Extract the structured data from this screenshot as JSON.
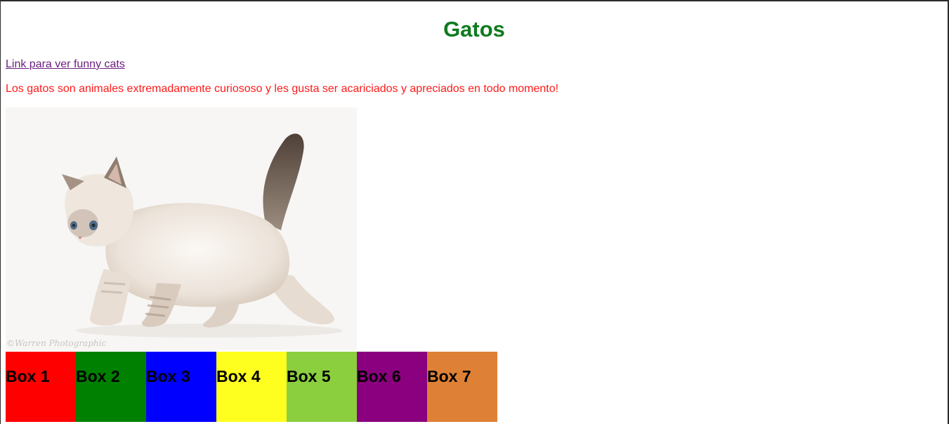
{
  "page": {
    "title": "Gatos",
    "link_text": "Link para ver funny cats",
    "description": "Los gatos son animales extremadamente curiososo y les gusta ser acariciados y apreciados en todo momento!"
  },
  "image": {
    "subject": "kitten-photo",
    "watermark": "©Warren Photographic"
  },
  "boxes": [
    {
      "label": "Box 1",
      "color": "#ff0000"
    },
    {
      "label": "Box 2",
      "color": "#008000"
    },
    {
      "label": "Box 3",
      "color": "#0000ff"
    },
    {
      "label": "Box 4",
      "color": "#ffff1f"
    },
    {
      "label": "Box 5",
      "color": "#8bcf3f"
    },
    {
      "label": "Box 6",
      "color": "#8a007e"
    },
    {
      "label": "Box 7",
      "color": "#de8136"
    }
  ]
}
